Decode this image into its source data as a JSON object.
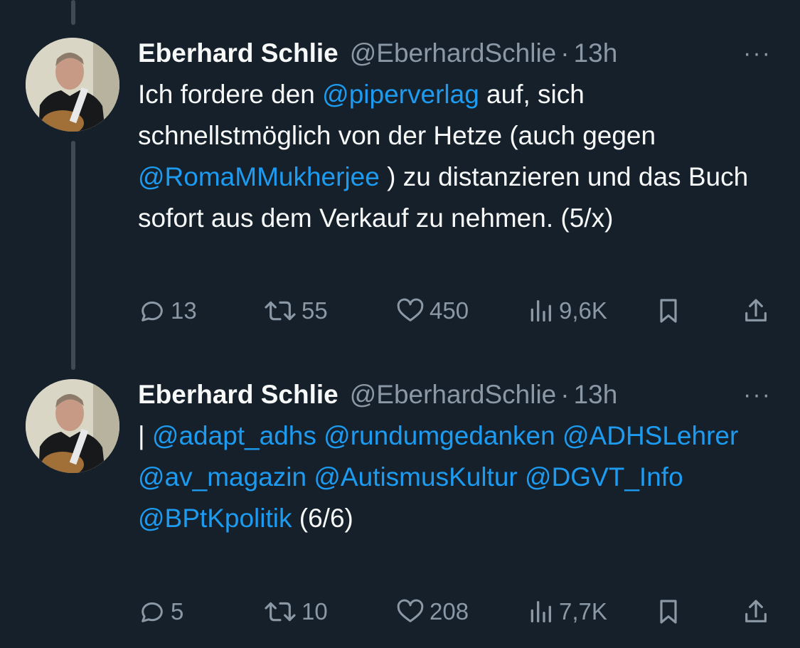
{
  "tweets": [
    {
      "name": "Eberhard Schlie",
      "handle": "@EberhardSchlie",
      "dot": "·",
      "time": "13h",
      "more": "···",
      "text": {
        "p1": "Ich fordere den ",
        "m1": "@piperverlag",
        "p2": " auf, sich schnellstmöglich von der Hetze (auch gegen ",
        "m2": "@RomaMMukherjee",
        "p3": " ) zu distanzieren und das Buch sofort aus dem Verkauf zu nehmen. (5/x)"
      },
      "stats": {
        "replies": "13",
        "retweets": "55",
        "likes": "450",
        "views": "9,6K"
      }
    },
    {
      "name": "Eberhard Schlie",
      "handle": "@EberhardSchlie",
      "dot": "·",
      "time": "13h",
      "more": "···",
      "text": {
        "p0": "| ",
        "m1": "@adapt_adhs",
        "m2": "@rundumgedanken",
        "m3": "@ADHSLehrer",
        "m4": "@av_magazin",
        "m5": "@AutismusKultur",
        "m6": "@DGVT_Info",
        "m7": "@BPtKpolitik",
        "p1": " (6/6)"
      },
      "stats": {
        "replies": "5",
        "retweets": "10",
        "likes": "208",
        "views": "7,7K"
      }
    }
  ],
  "colors": {
    "background": "#15202b",
    "text": "#f7f9f9",
    "muted": "#8b98a5",
    "link": "#1d9bf0",
    "thread_line": "#3e4a56"
  },
  "icons": [
    "reply-icon",
    "retweet-icon",
    "like-icon",
    "views-icon",
    "bookmark-icon",
    "share-icon",
    "more-icon"
  ]
}
